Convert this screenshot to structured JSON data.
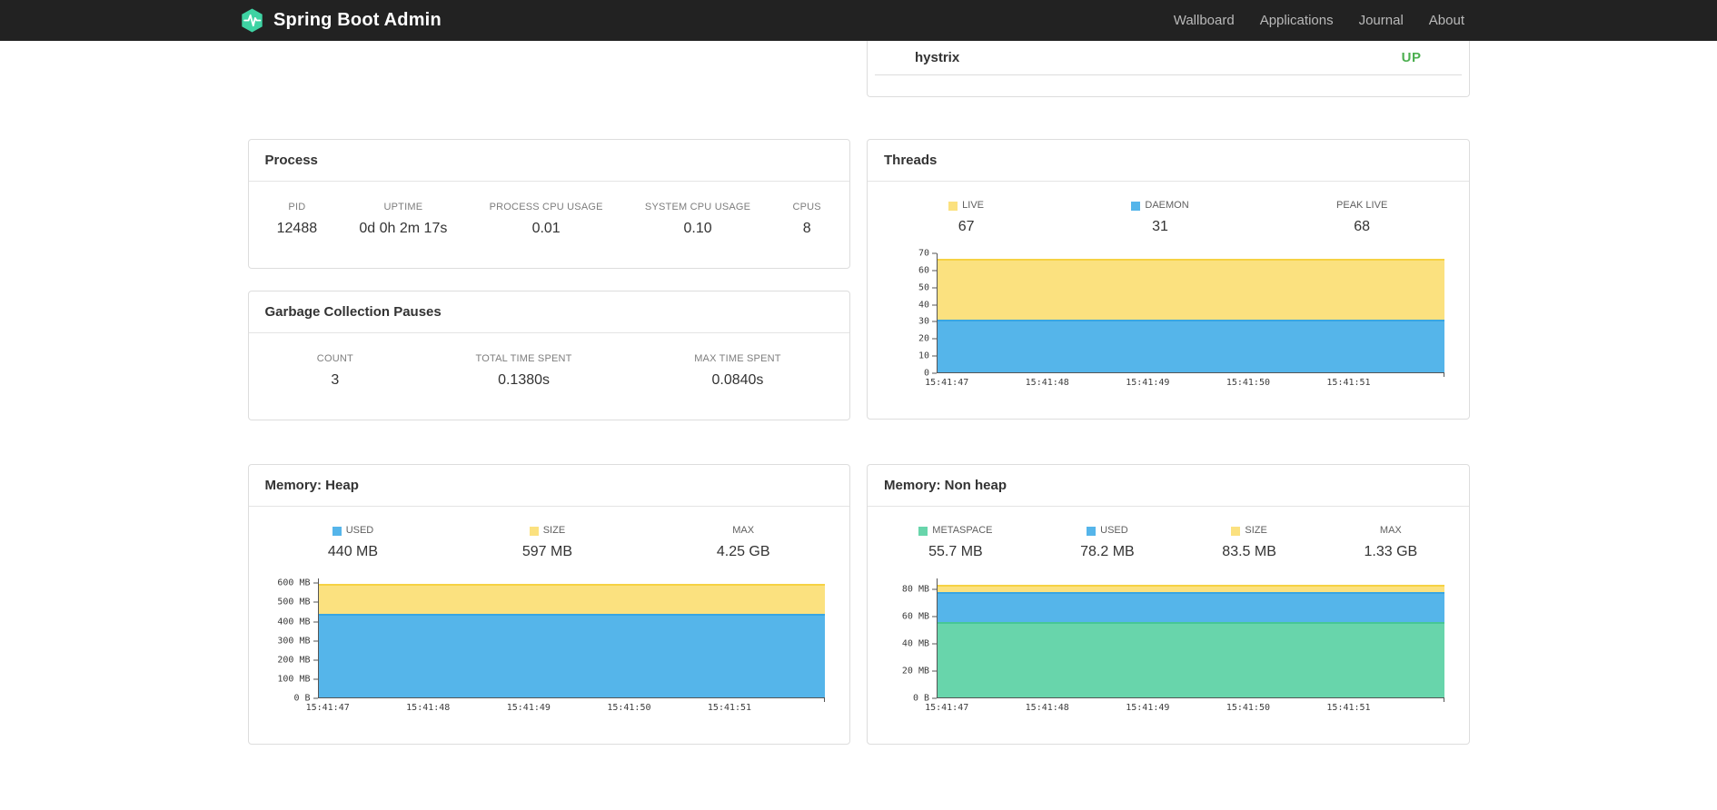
{
  "navbar": {
    "brand": "Spring Boot Admin",
    "links": [
      "Wallboard",
      "Applications",
      "Journal",
      "About"
    ],
    "background": "#222222",
    "brand_logo_color": "#3ed3a3"
  },
  "status_panel": {
    "application": "hystrix",
    "status": "UP",
    "status_color": "#4caf50"
  },
  "process": {
    "title": "Process",
    "metrics": [
      {
        "label": "PID",
        "value": "12488"
      },
      {
        "label": "UPTIME",
        "value": "0d 0h 2m 17s"
      },
      {
        "label": "PROCESS CPU USAGE",
        "value": "0.01"
      },
      {
        "label": "SYSTEM CPU USAGE",
        "value": "0.10"
      },
      {
        "label": "CPUS",
        "value": "8"
      }
    ]
  },
  "gc": {
    "title": "Garbage Collection Pauses",
    "metrics": [
      {
        "label": "COUNT",
        "value": "3"
      },
      {
        "label": "TOTAL TIME SPENT",
        "value": "0.1380s"
      },
      {
        "label": "MAX TIME SPENT",
        "value": "0.0840s"
      }
    ]
  },
  "chart_data": [
    {
      "id": "threads",
      "type": "area",
      "title": "Threads",
      "xlabel": "",
      "ylabel": "",
      "x": [
        "15:41:47",
        "15:41:48",
        "15:41:49",
        "15:41:50",
        "15:41:51"
      ],
      "ylim": [
        0,
        70
      ],
      "yticks": [
        {
          "v": 0,
          "label": "0"
        },
        {
          "v": 10,
          "label": "10"
        },
        {
          "v": 20,
          "label": "20"
        },
        {
          "v": 30,
          "label": "30"
        },
        {
          "v": 40,
          "label": "40"
        },
        {
          "v": 50,
          "label": "50"
        },
        {
          "v": 60,
          "label": "60"
        },
        {
          "v": 70,
          "label": "70"
        }
      ],
      "legend": [
        {
          "label": "LIVE",
          "value": "67",
          "color": "#fbe17f"
        },
        {
          "label": "DAEMON",
          "value": "31",
          "color": "#55b5ea"
        },
        {
          "label": "PEAK LIVE",
          "value": "68",
          "color": ""
        }
      ],
      "series": [
        {
          "name": "LIVE",
          "color": "#fbe17f",
          "line": "#f6d243",
          "values": [
            67,
            67,
            67,
            67,
            67
          ]
        },
        {
          "name": "DAEMON",
          "color": "#55b5ea",
          "line": "#38a6e3",
          "values": [
            31,
            31,
            31,
            31,
            31
          ]
        }
      ]
    },
    {
      "id": "memory-heap",
      "type": "area",
      "title": "Memory: Heap",
      "xlabel": "",
      "ylabel": "",
      "x": [
        "15:41:47",
        "15:41:48",
        "15:41:49",
        "15:41:50",
        "15:41:51"
      ],
      "ylim": [
        0,
        625
      ],
      "yticks": [
        {
          "v": 0,
          "label": "0 B"
        },
        {
          "v": 100,
          "label": "100 MB"
        },
        {
          "v": 200,
          "label": "200 MB"
        },
        {
          "v": 300,
          "label": "300 MB"
        },
        {
          "v": 400,
          "label": "400 MB"
        },
        {
          "v": 500,
          "label": "500 MB"
        },
        {
          "v": 600,
          "label": "600 MB"
        }
      ],
      "legend": [
        {
          "label": "USED",
          "value": "440 MB",
          "color": "#55b5ea"
        },
        {
          "label": "SIZE",
          "value": "597 MB",
          "color": "#fbe17f"
        },
        {
          "label": "MAX",
          "value": "4.25 GB",
          "color": ""
        }
      ],
      "series": [
        {
          "name": "SIZE",
          "color": "#fbe17f",
          "line": "#f6d243",
          "values": [
            597,
            597,
            597,
            597,
            597
          ]
        },
        {
          "name": "USED",
          "color": "#55b5ea",
          "line": "#38a6e3",
          "values": [
            440,
            440,
            440,
            440,
            440
          ]
        }
      ]
    },
    {
      "id": "memory-non-heap",
      "type": "area",
      "title": "Memory: Non heap",
      "xlabel": "",
      "ylabel": "",
      "x": [
        "15:41:47",
        "15:41:48",
        "15:41:49",
        "15:41:50",
        "15:41:51"
      ],
      "ylim": [
        0,
        88
      ],
      "yticks": [
        {
          "v": 0,
          "label": "0 B"
        },
        {
          "v": 20,
          "label": "20 MB"
        },
        {
          "v": 40,
          "label": "40 MB"
        },
        {
          "v": 60,
          "label": "60 MB"
        },
        {
          "v": 80,
          "label": "80 MB"
        }
      ],
      "legend": [
        {
          "label": "METASPACE",
          "value": "55.7 MB",
          "color": "#68d5ab"
        },
        {
          "label": "USED",
          "value": "78.2 MB",
          "color": "#55b5ea"
        },
        {
          "label": "SIZE",
          "value": "83.5 MB",
          "color": "#fbe17f"
        },
        {
          "label": "MAX",
          "value": "1.33 GB",
          "color": ""
        }
      ],
      "series": [
        {
          "name": "SIZE",
          "color": "#fbe17f",
          "line": "#f6d243",
          "values": [
            83.5,
            83.5,
            83.5,
            83.5,
            83.5
          ]
        },
        {
          "name": "USED",
          "color": "#55b5ea",
          "line": "#38a6e3",
          "values": [
            78.2,
            78.2,
            78.2,
            78.2,
            78.2
          ]
        },
        {
          "name": "METASPACE",
          "color": "#68d5ab",
          "line": "#47c795",
          "values": [
            55.7,
            55.7,
            55.7,
            55.7,
            55.7
          ]
        }
      ]
    }
  ]
}
